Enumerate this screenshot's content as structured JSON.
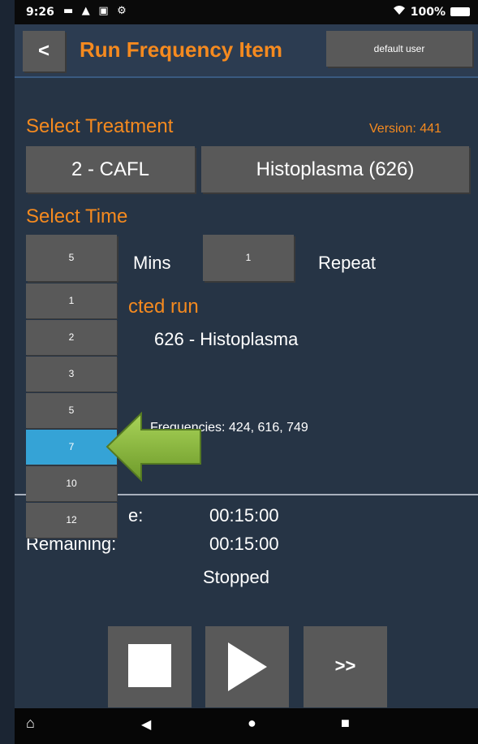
{
  "status_bar": {
    "time": "9:26",
    "left_icons": "▬ ▲ ▣ ⚙",
    "battery_text": "100%"
  },
  "header": {
    "back_label": "<",
    "title": "Run Frequency Item",
    "user_label": "default user"
  },
  "treatment": {
    "section_label": "Select Treatment",
    "version": "Version: 441",
    "treatment_value": "2 -  CAFL",
    "item_value": "Histoplasma (626)"
  },
  "time": {
    "section_label": "Select Time",
    "mins_value": "5",
    "mins_label": "Mins",
    "repeat_value": "1",
    "repeat_label": "Repeat"
  },
  "minutes_dropdown": {
    "options": [
      "1",
      "2",
      "3",
      "5",
      "7",
      "10",
      "12"
    ],
    "selected_index": 4
  },
  "selected_run": {
    "label_partial": "cted run",
    "name": "626 -  Histoplasma",
    "frequencies": "Frequencies: 424, 616, 749"
  },
  "timer": {
    "total_label_partial": "e:",
    "total_value": "00:15:00",
    "remaining_label": "Remaining:",
    "remaining_value": "00:15:00",
    "status": "Stopped"
  },
  "controls": {
    "skip_label": ">>"
  },
  "colors": {
    "accent": "#f58a1f",
    "background": "#263445",
    "button": "#595959",
    "selected": "#35a3d6",
    "arrow": "#8fbe3c"
  }
}
